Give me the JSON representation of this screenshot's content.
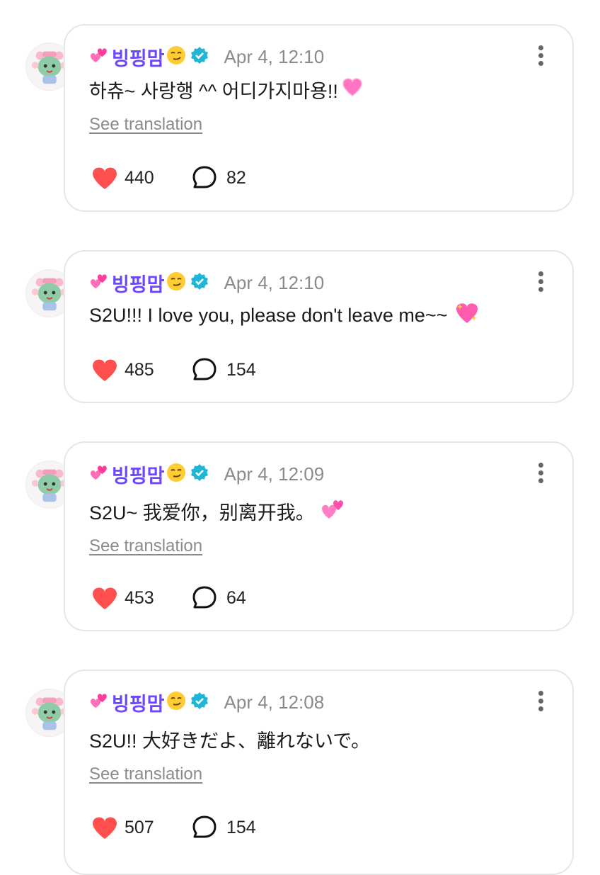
{
  "posts": [
    {
      "author": "빙핑맘",
      "timestamp": "Apr 4, 12:10",
      "text": "하츄~ 사랑행 ^^ 어디가지마용!!",
      "trailing_emoji": "growing-heart",
      "see_translation": "See translation",
      "likes": "440",
      "replies": "82"
    },
    {
      "author": "빙핑맘",
      "timestamp": "Apr 4, 12:10",
      "text": "S2U!!! I love you, please don't leave me~~",
      "trailing_emoji": "sparkling-heart",
      "see_translation": "",
      "likes": "485",
      "replies": "154"
    },
    {
      "author": "빙핑맘",
      "timestamp": "Apr 4, 12:09",
      "text": "S2U~ 我爱你，别离开我。",
      "trailing_emoji": "two-hearts",
      "see_translation": "See translation",
      "likes": "453",
      "replies": "64"
    },
    {
      "author": "빙핑맘",
      "timestamp": "Apr 4, 12:08",
      "text": "S2U!! 大好きだよ、離れないで。",
      "trailing_emoji": "",
      "see_translation": "See translation",
      "likes": "507",
      "replies": "154"
    }
  ],
  "icons": {
    "name_prefix": "two-hearts-icon",
    "name_suffix": "smirking-face-icon",
    "verified": "verified-badge-icon",
    "like": "heart-icon",
    "reply": "speech-bubble-icon",
    "more": "more-vertical-icon"
  },
  "colors": {
    "author": "#6b47ff",
    "timestamp": "#8a8a8a",
    "like": "#ff4f4f",
    "verified": "#1fb6d6",
    "card_border": "#e6e6e6"
  }
}
